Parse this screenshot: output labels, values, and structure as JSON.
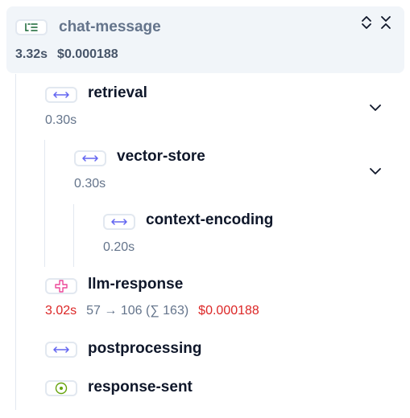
{
  "root": {
    "title": "chat-message",
    "duration": "3.32s",
    "cost": "$0.000188",
    "icon": "list-tree-icon",
    "accent": "#166534"
  },
  "spans": [
    {
      "title": "retrieval",
      "duration": "0.30s",
      "icon": "arrows-left-right-icon"
    },
    {
      "title": "vector-store",
      "duration": "0.30s",
      "icon": "arrows-left-right-icon"
    },
    {
      "title": "context-encoding",
      "duration": "0.20s",
      "icon": "arrows-left-right-icon"
    },
    {
      "title": "llm-response",
      "duration": "3.02s",
      "tokens": "57 → 106 (∑ 163)",
      "cost": "$0.000188",
      "icon": "sparkle-icon"
    },
    {
      "title": "postprocessing",
      "icon": "arrows-left-right-icon"
    },
    {
      "title": "response-sent",
      "icon": "event-dot-icon"
    }
  ],
  "colors": {
    "span_icon": "#6366f1",
    "generation_icon": "#ec4899",
    "event_icon": "#65a30d",
    "error_text": "#dc2626",
    "muted_text": "#64748b"
  }
}
